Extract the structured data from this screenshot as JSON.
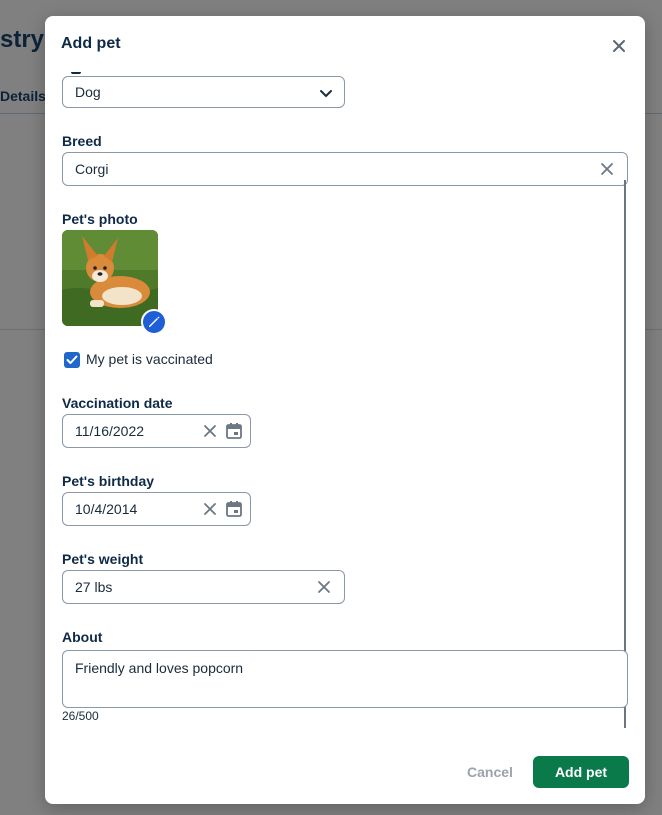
{
  "background": {
    "title": "stry",
    "tab": "Details"
  },
  "modal": {
    "title": "Add pet",
    "type_field": {
      "value": "Dog"
    },
    "breed": {
      "label": "Breed",
      "value": "Corgi"
    },
    "photo": {
      "label": "Pet's photo"
    },
    "vaccinated": {
      "label": "My pet is vaccinated",
      "checked": true
    },
    "vaccination_date": {
      "label": "Vaccination date",
      "value": "11/16/2022"
    },
    "birthday": {
      "label": "Pet's birthday",
      "value": "10/4/2014"
    },
    "weight": {
      "label": "Pet's weight",
      "value": "27 lbs"
    },
    "about": {
      "label": "About",
      "value": "Friendly and loves popcorn",
      "counter": "26/500"
    },
    "cancel_label": "Cancel",
    "submit_label": "Add pet"
  },
  "colors": {
    "primary": "#0a7a4a",
    "accent": "#1f5fd6",
    "checkbox": "#1f68c9",
    "text": "#0e2a47"
  },
  "icons": [
    "close-icon",
    "chevron-down-icon",
    "clear-icon",
    "calendar-icon",
    "pencil-icon",
    "check-icon"
  ]
}
